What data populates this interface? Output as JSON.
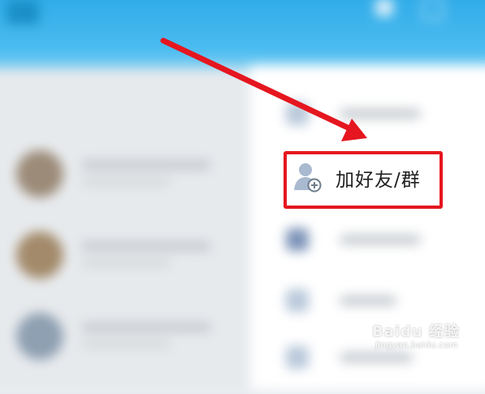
{
  "menu": {
    "highlighted_item": {
      "label": "加好友/群",
      "icon": "add-contact-icon"
    }
  },
  "annotation": {
    "arrow_color": "#e5161f",
    "box_color": "#e5161f"
  },
  "watermark": {
    "brand": "Baidu 经验",
    "sub": "jingyan.baidu.com"
  },
  "colors": {
    "header_blue": "#2aa7e6",
    "menu_bg": "#ffffff"
  }
}
